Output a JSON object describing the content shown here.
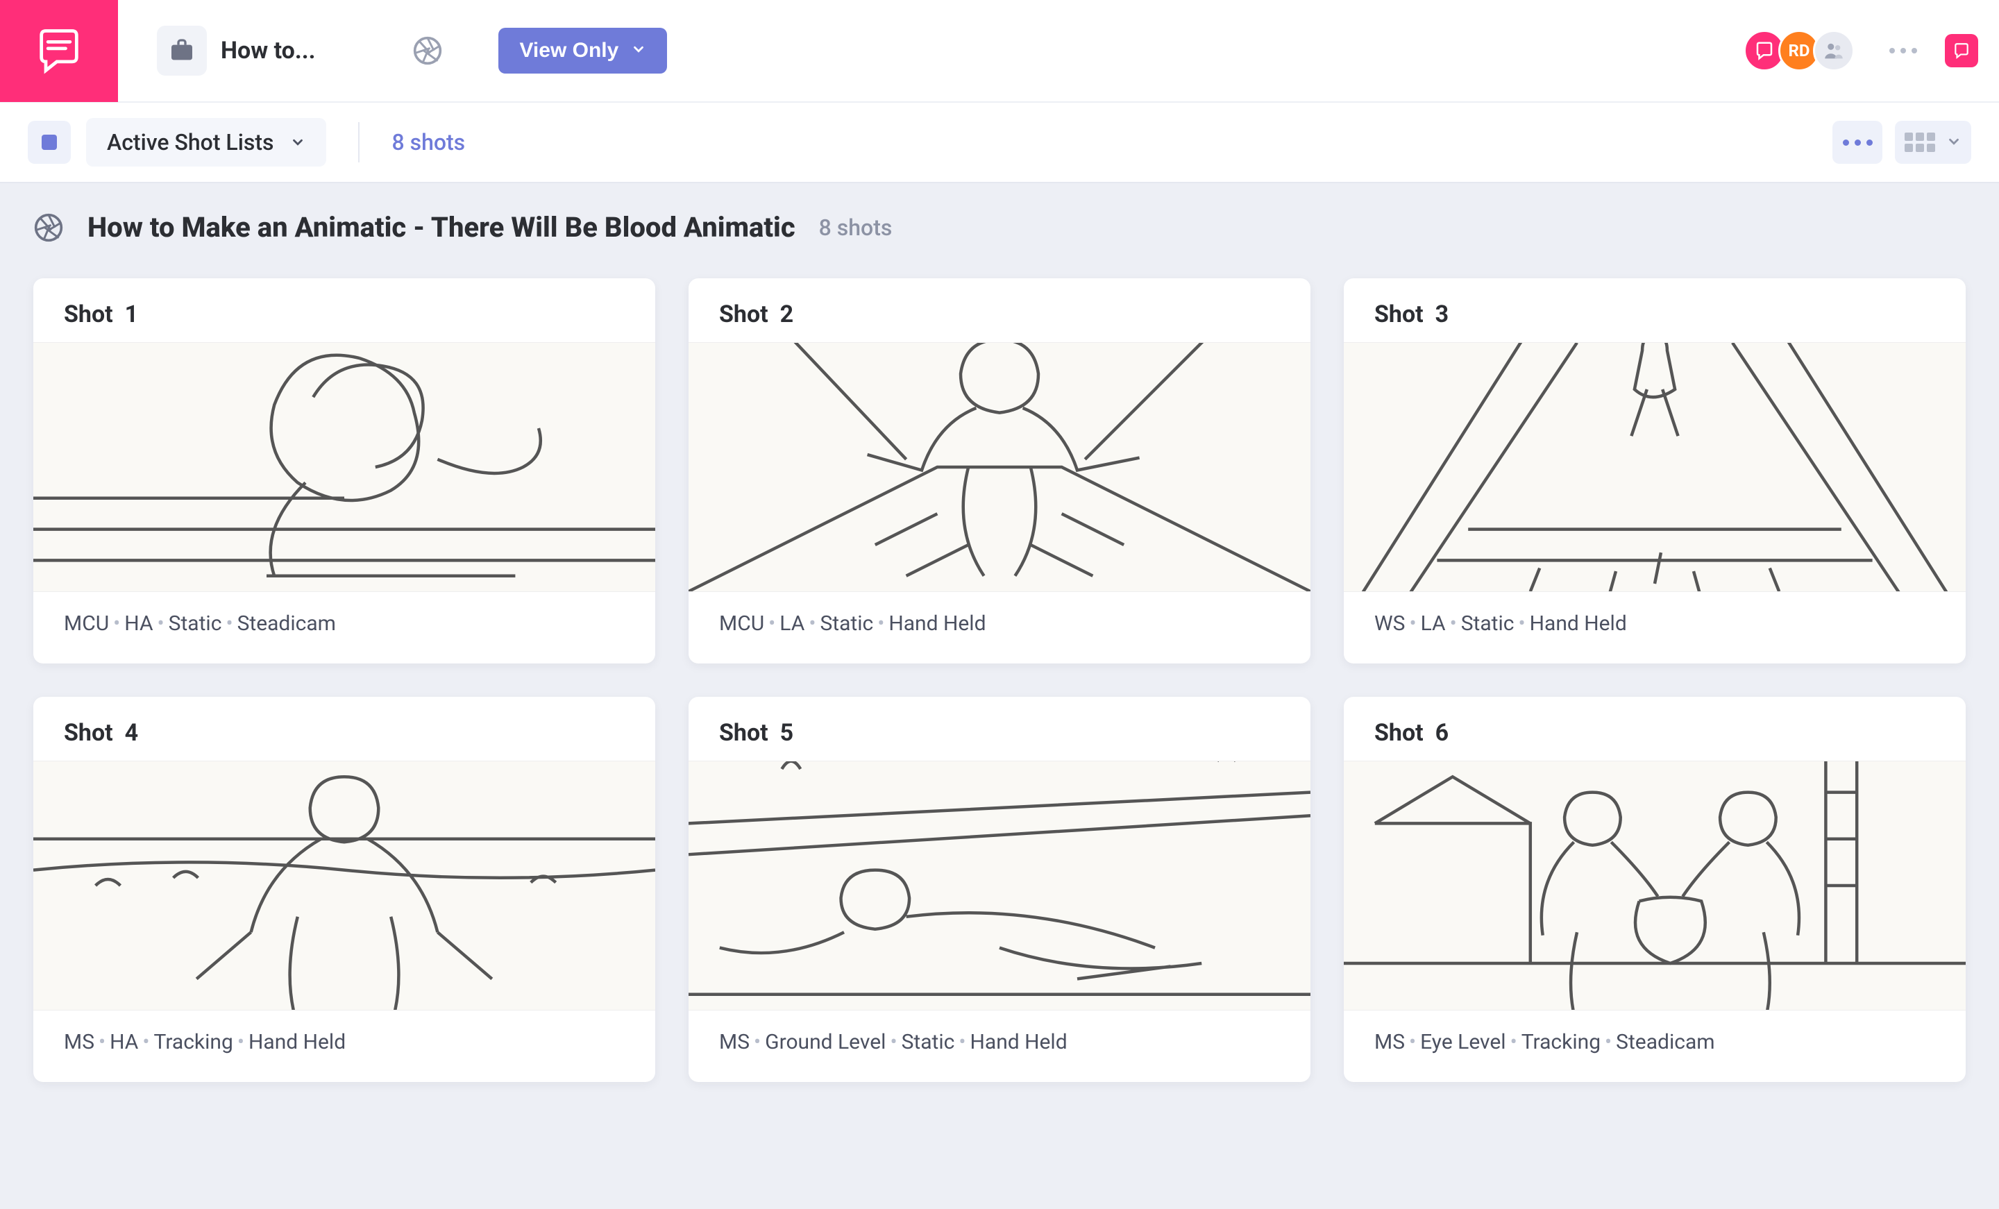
{
  "app": {
    "project_name": "How to...",
    "view_mode_label": "View Only"
  },
  "users": {
    "avatar2_initials": "RD"
  },
  "filter": {
    "dropdown_label": "Active Shot Lists",
    "shot_count_label": "8 shots"
  },
  "page": {
    "title": "How to Make an Animatic - There Will Be Blood Animatic",
    "subtitle": "8 shots"
  },
  "shots": [
    {
      "label": "Shot",
      "num": "1",
      "size": "MCU",
      "angle": "HA",
      "move": "Static",
      "rig": "Steadicam"
    },
    {
      "label": "Shot",
      "num": "2",
      "size": "MCU",
      "angle": "LA",
      "move": "Static",
      "rig": "Hand Held"
    },
    {
      "label": "Shot",
      "num": "3",
      "size": "WS",
      "angle": "LA",
      "move": "Static",
      "rig": "Hand Held"
    },
    {
      "label": "Shot",
      "num": "4",
      "size": "MS",
      "angle": "HA",
      "move": "Tracking",
      "rig": "Hand Held"
    },
    {
      "label": "Shot",
      "num": "5",
      "size": "MS",
      "angle": "Ground Level",
      "move": "Static",
      "rig": "Hand Held"
    },
    {
      "label": "Shot",
      "num": "6",
      "size": "MS",
      "angle": "Eye Level",
      "move": "Tracking",
      "rig": "Steadicam"
    }
  ]
}
